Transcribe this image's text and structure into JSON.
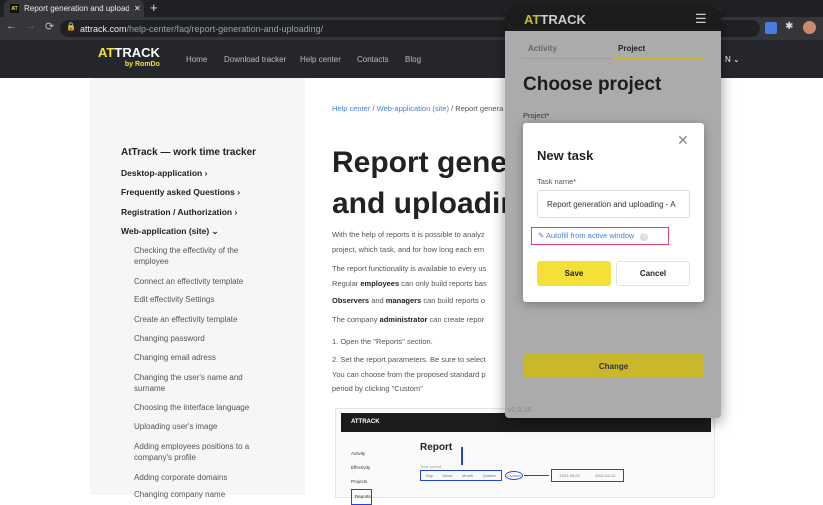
{
  "browser": {
    "tab_title": "Report generation and uploadi",
    "url_domain": "attrack.com",
    "url_path": "/help-center/faq/report-generation-and-uploading/"
  },
  "site": {
    "logo": "ATTRACK",
    "logo_sub": "by RomDo",
    "menu": [
      "Home",
      "Download tracker",
      "Help center",
      "Contacts",
      "Blog"
    ],
    "lang": "N"
  },
  "sidebar": {
    "title": "AtTrack — work time tracker",
    "sections": [
      "Desktop-application",
      "Frequently asked Questions",
      "Registration / Authorization",
      "Web-application (site)"
    ],
    "items": [
      "Checking the effectivity of the employee",
      "Connect an effectivity template",
      "Edit effectivity Settings",
      "Create an effectivity template",
      "Changing password",
      "Changing email adress",
      "Changing the user's name and surname",
      "Choosing the interface language",
      "Uploading user's image",
      "Adding employees positions to a company's profile",
      "Adding corporate domains",
      "Changing company name"
    ]
  },
  "article": {
    "breadcrumb": [
      "Help center",
      "Web-application (site)",
      "Report genera"
    ],
    "title": "Report generation and uploading",
    "p1a": "With the help of reports it is possible to analyz",
    "p1b": "project, which task, and for how long each em",
    "p2a": "The report functionality is available to every us",
    "p2b_pre": "Regular ",
    "p2b_bold": "employees",
    "p2b_post": " can only build reports bas",
    "p3_b1": "Observers",
    "p3_mid": " and ",
    "p3_b2": "managers",
    "p3_post": " can build reports o",
    "p4_pre": "The company ",
    "p4_bold": "administrator",
    "p4_post": " can create repor",
    "step1": "1. Open the \"Reports\" section.",
    "step2a": "2. Set the report parameters. Be sure to select",
    "step2b": "You can choose from the proposed standard p",
    "step2c": "period by clicking \"Custom\"",
    "screenshot": {
      "logo": "ATTRACK",
      "nav": [
        "Activity",
        "Effectivity",
        "Projects",
        "Reports"
      ],
      "title": "Report",
      "label": "Time period",
      "periods": [
        "Day",
        "Week",
        "Month",
        "Quarter"
      ],
      "custom": "Custom",
      "date_from": "2021-04-01",
      "date_to": "2021-04-12"
    }
  },
  "popup": {
    "logo": "ATTRACK",
    "tabs": [
      "Activity",
      "Project"
    ],
    "active_tab": "Project",
    "heading": "Choose project",
    "project_label": "Project*",
    "change": "Change",
    "version": "v2.3.18",
    "modal": {
      "title": "New task",
      "task_label": "Task name*",
      "task_value": "Report generation and uploading - A",
      "autofill": "Autofill from active window",
      "save": "Save",
      "cancel": "Cancel"
    }
  }
}
